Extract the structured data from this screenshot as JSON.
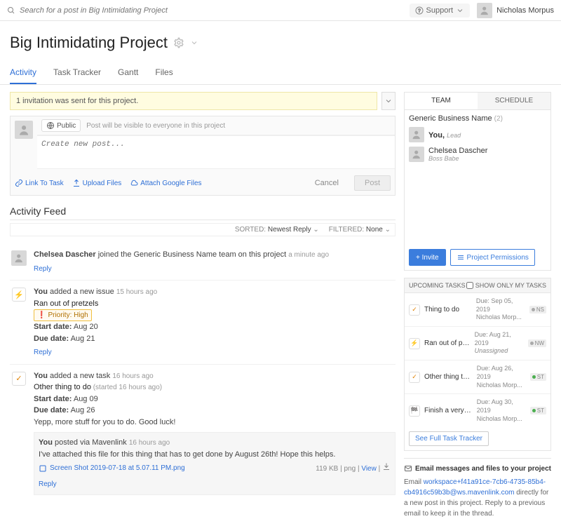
{
  "topbar": {
    "search_placeholder": "Search for a post in Big Intimidating Project",
    "support": "Support",
    "user_name": "Nicholas Morpus"
  },
  "header": {
    "title": "Big Intimidating Project"
  },
  "tabs": [
    "Activity",
    "Task Tracker",
    "Gantt",
    "Files"
  ],
  "notice": "1 invitation was sent for this project.",
  "compose": {
    "visibility_label": "Public",
    "visibility_text": "Post will be visible to everyone in this project",
    "placeholder": "Create new post...",
    "link_task": "Link To Task",
    "upload": "Upload Files",
    "attach_google": "Attach Google Files",
    "cancel": "Cancel",
    "post": "Post"
  },
  "feed": {
    "heading": "Activity Feed",
    "sorted_label": "SORTED:",
    "sorted_value": "Newest Reply",
    "filtered_label": "FILTERED:",
    "filtered_value": "None",
    "items": [
      {
        "actor": "Chelsea Dascher",
        "verb": " joined the Generic Business Name team on this project ",
        "time": "a minute ago",
        "reply": "Reply"
      },
      {
        "actor": "You",
        "verb": " added a new issue ",
        "time": "15 hours ago",
        "title": "Ran out of pretzels",
        "priority": "Priority: High",
        "start_label": "Start date:",
        "start": " Aug 20",
        "due_label": "Due date:",
        "due": " Aug 21",
        "reply": "Reply"
      },
      {
        "actor": "You",
        "verb": " added a new task ",
        "time": "16 hours ago",
        "title": "Other thing to do",
        "title_meta": " (started 16 hours ago)",
        "start_label": "Start date:",
        "start": " Aug 09",
        "due_label": "Due date:",
        "due": " Aug 26",
        "note": "Yepp, more stuff for you to do. Good luck!",
        "nested": {
          "actor": "You",
          "verb": " posted via Mavenlink ",
          "time": "16 hours ago",
          "body": "I've attached this file for this thing that has to get done by August 26th! Hope this helps.",
          "file": "Screen Shot 2019-07-18 at 5.07.11 PM.png",
          "file_meta": "119 KB | png | ",
          "view": "View",
          "reply": "Reply"
        }
      }
    ]
  },
  "side": {
    "team_tab": "TEAM",
    "schedule_tab": "SCHEDULE",
    "team_name": "Generic Business Name",
    "team_count": "(2)",
    "members": [
      {
        "name": "You, ",
        "role": "Lead"
      },
      {
        "name": "Chelsea Dascher",
        "role": "Boss Babe"
      }
    ],
    "invite": "Invite",
    "permissions": "Project Permissions",
    "upcoming": {
      "heading": "UPCOMING TASKS",
      "show_only": "SHOW ONLY MY TASKS",
      "tasks": [
        {
          "name": "Thing to do",
          "due": "Due: Sep 05, 2019",
          "assignee": "Nicholas Morp...",
          "badge": "NS",
          "dot": ""
        },
        {
          "name": "Ran out of pretzels",
          "due": "Due: Aug 21, 2019",
          "assignee": "Unassigned",
          "badge": "NW",
          "dot": ""
        },
        {
          "name": "Other thing to do",
          "due": "Due: Aug 26, 2019",
          "assignee": "Nicholas Morp...",
          "badge": "ST",
          "dot": "green"
        },
        {
          "name": "Finish a very importa...",
          "due": "Due: Aug 30, 2019",
          "assignee": "Nicholas Morp...",
          "badge": "ST",
          "dot": "green"
        }
      ],
      "see_full": "See Full Task Tracker"
    },
    "email": {
      "heading": "Email messages and files to your project",
      "prefix": "Email ",
      "address": "workspace+f41a91ce-7cb6-4735-85b4-cb4916c59b3b@ws.mavenlink.com",
      "suffix": " directly for a new post in this project. Reply to a previous email to keep it in the thread."
    }
  }
}
